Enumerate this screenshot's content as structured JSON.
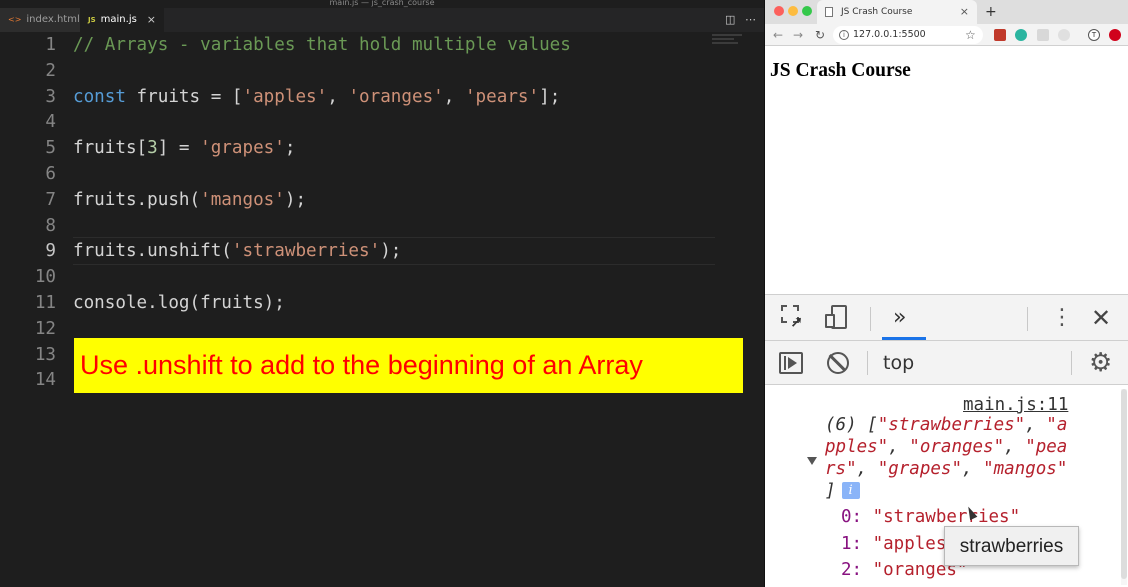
{
  "editor": {
    "window_title": "main.js — js_crash_course",
    "tabs": [
      {
        "label": "index.html",
        "icon": "html-file-icon"
      },
      {
        "label": "main.js",
        "icon": "js-file-icon",
        "badge": "JS",
        "close": "×"
      }
    ],
    "html_badge": "<>",
    "split_icon": "◫",
    "more_icon": "⋯",
    "current_line": 9,
    "lines": [
      {
        "n": "1",
        "parts": [
          {
            "c": "cm",
            "t": "// Arrays - variables that hold multiple values"
          }
        ]
      },
      {
        "n": "2",
        "parts": []
      },
      {
        "n": "3",
        "parts": [
          {
            "c": "kw",
            "t": "const"
          },
          {
            "c": "",
            "t": " fruits = ["
          },
          {
            "c": "str",
            "t": "'apples'"
          },
          {
            "c": "",
            "t": ", "
          },
          {
            "c": "str",
            "t": "'oranges'"
          },
          {
            "c": "",
            "t": ", "
          },
          {
            "c": "str",
            "t": "'pears'"
          },
          {
            "c": "",
            "t": "];"
          }
        ]
      },
      {
        "n": "4",
        "parts": []
      },
      {
        "n": "5",
        "parts": [
          {
            "c": "",
            "t": "fruits["
          },
          {
            "c": "num",
            "t": "3"
          },
          {
            "c": "",
            "t": "] = "
          },
          {
            "c": "str",
            "t": "'grapes'"
          },
          {
            "c": "",
            "t": ";"
          }
        ]
      },
      {
        "n": "6",
        "parts": []
      },
      {
        "n": "7",
        "parts": [
          {
            "c": "",
            "t": "fruits.push("
          },
          {
            "c": "str",
            "t": "'mangos'"
          },
          {
            "c": "",
            "t": ");"
          }
        ]
      },
      {
        "n": "8",
        "parts": []
      },
      {
        "n": "9",
        "parts": [
          {
            "c": "",
            "t": "fruits.unshift("
          },
          {
            "c": "str",
            "t": "'strawberries'"
          },
          {
            "c": "",
            "t": ");"
          }
        ]
      },
      {
        "n": "10",
        "parts": []
      },
      {
        "n": "11",
        "parts": [
          {
            "c": "",
            "t": "console.log(fruits);"
          }
        ]
      },
      {
        "n": "12",
        "parts": []
      },
      {
        "n": "13",
        "parts": []
      },
      {
        "n": "14",
        "parts": []
      }
    ],
    "banner": "Use .unshift to add to the beginning of an Array",
    "banner_bg": "#ffff00",
    "banner_fg": "#ff0000"
  },
  "browser": {
    "tab_title": "JS Crash Course",
    "tab_close": "×",
    "new_tab": "+",
    "back": "←",
    "forward": "→",
    "reload": "↻",
    "url": "127.0.0.1:5500",
    "info": "i",
    "star": "☆",
    "ext_t": "T",
    "page_heading": "JS Crash Course"
  },
  "devtools": {
    "more_tabs": "»",
    "kebab": "⋮",
    "close": "✕",
    "context": "top",
    "gear": "⚙",
    "log_source": "main.js:11",
    "log_lines": [
      [
        {
          "c": "d i",
          "t": "(6) ["
        },
        {
          "c": "s i",
          "t": "\"strawberries\""
        },
        {
          "c": "d i",
          "t": ", "
        },
        {
          "c": "s i",
          "t": "\"a"
        }
      ],
      [
        {
          "c": "s i",
          "t": "pples\""
        },
        {
          "c": "d i",
          "t": ", "
        },
        {
          "c": "s i",
          "t": "\"oranges\""
        },
        {
          "c": "d i",
          "t": ", "
        },
        {
          "c": "s i",
          "t": "\"pea"
        }
      ],
      [
        {
          "c": "s i",
          "t": "rs\""
        },
        {
          "c": "d i",
          "t": ", "
        },
        {
          "c": "s i",
          "t": "\"grapes\""
        },
        {
          "c": "d i",
          "t": ", "
        },
        {
          "c": "s i",
          "t": "\"mangos\""
        }
      ],
      [
        {
          "c": "d i",
          "t": "]"
        }
      ]
    ],
    "info_badge": "i",
    "entries": [
      {
        "k": "0: ",
        "v": "\"strawberries\""
      },
      {
        "k": "1: ",
        "v": "\"apples\""
      },
      {
        "k": "2: ",
        "v": "\"oranges\""
      }
    ],
    "tooltip": "strawberries"
  }
}
